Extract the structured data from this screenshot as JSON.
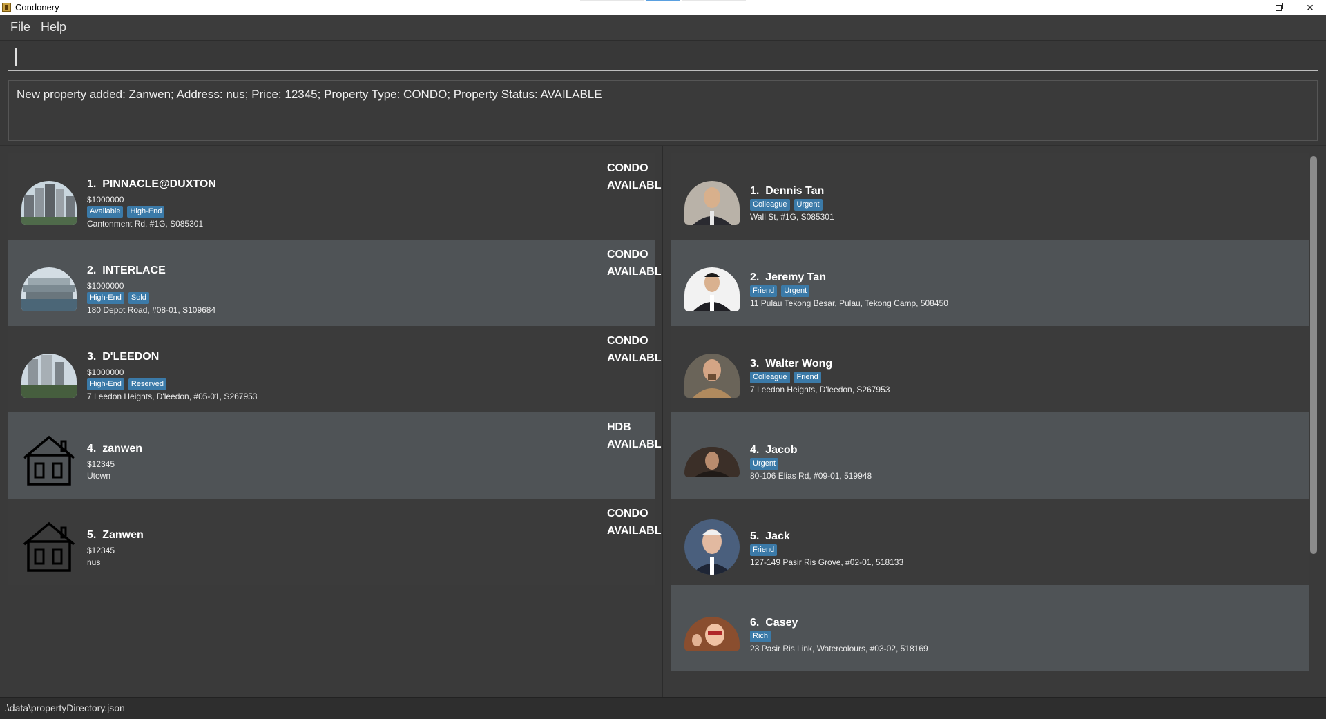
{
  "window": {
    "title": "Condonery"
  },
  "menu": {
    "file": "File",
    "help": "Help"
  },
  "command": {
    "value": ""
  },
  "result": "New property added: Zanwen; Address: nus; Price: 12345; Property Type: CONDO; Property Status: AVAILABLE",
  "properties": [
    {
      "index": "1.",
      "name": "PINNACLE@DUXTON",
      "price": "$1000000",
      "tags": [
        "Available",
        "High-End"
      ],
      "address": "Cantonment Rd, #1G, S085301",
      "type": "CONDO",
      "status": "AVAILABLE",
      "image": "building-photo"
    },
    {
      "index": "2.",
      "name": "INTERLACE",
      "price": "$1000000",
      "tags": [
        "High-End",
        "Sold"
      ],
      "address": "180 Depot Road, #08-01, S109684",
      "type": "CONDO",
      "status": "AVAILABLE",
      "image": "building-photo"
    },
    {
      "index": "3.",
      "name": "D'LEEDON",
      "price": "$1000000",
      "tags": [
        "High-End",
        "Reserved"
      ],
      "address": "7 Leedon Heights, D'leedon, #05-01, S267953",
      "type": "CONDO",
      "status": "AVAILABLE",
      "image": "building-photo"
    },
    {
      "index": "4.",
      "name": "zanwen",
      "price": "$12345",
      "tags": [],
      "address": "Utown",
      "type": "HDB",
      "status": "AVAILABLE",
      "image": "house-icon"
    },
    {
      "index": "5.",
      "name": "Zanwen",
      "price": "$12345",
      "tags": [],
      "address": "nus",
      "type": "CONDO",
      "status": "AVAILABLE",
      "image": "house-icon"
    }
  ],
  "clients": [
    {
      "index": "1.",
      "name": "Dennis Tan",
      "tags": [
        "Colleague",
        "Urgent"
      ],
      "address": "Wall St, #1G, S085301"
    },
    {
      "index": "2.",
      "name": "Jeremy Tan",
      "tags": [
        "Friend",
        "Urgent"
      ],
      "address": "11 Pulau Tekong Besar, Pulau, Tekong Camp, 508450"
    },
    {
      "index": "3.",
      "name": "Walter Wong",
      "tags": [
        "Colleague",
        "Friend"
      ],
      "address": "7 Leedon Heights, D'leedon, S267953"
    },
    {
      "index": "4.",
      "name": "Jacob",
      "tags": [
        "Urgent"
      ],
      "address": "80-106 Elias Rd, #09-01, 519948"
    },
    {
      "index": "5.",
      "name": "Jack",
      "tags": [
        "Friend"
      ],
      "address": "127-149 Pasir Ris Grove, #02-01, 518133"
    },
    {
      "index": "6.",
      "name": "Casey",
      "tags": [
        "Rich"
      ],
      "address": "23 Pasir Ris Link, Watercolours, #03-02, 518169"
    }
  ],
  "status_bar": {
    "path": ".\\data\\propertyDirectory.json"
  },
  "colors": {
    "tag": "#3b7aa8",
    "background": "#383838",
    "card_alt": "#4f5356"
  }
}
